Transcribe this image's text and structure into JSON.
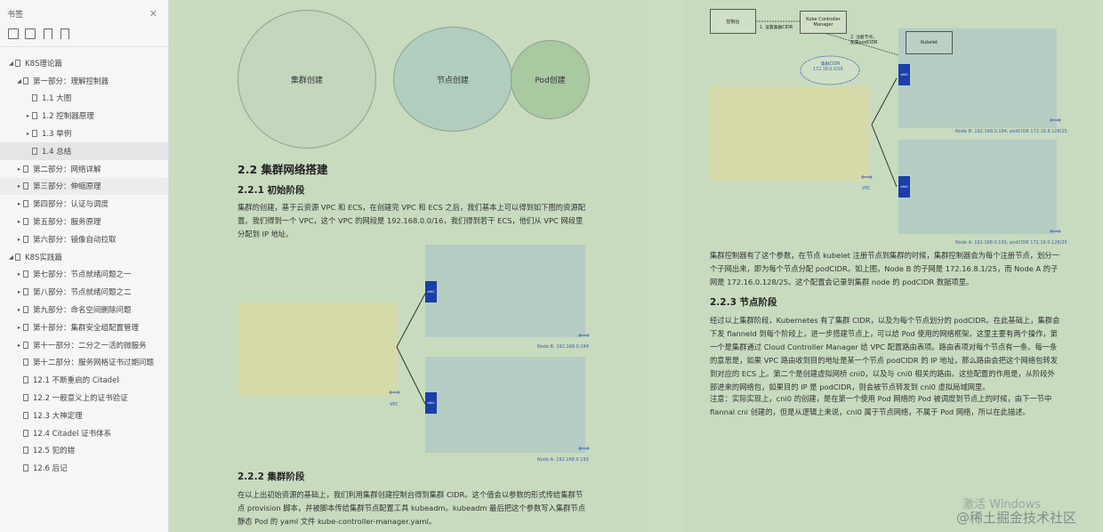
{
  "sidebar": {
    "title": "书签",
    "items": [
      {
        "label": "K8S理论篇",
        "arrow": "◢",
        "indent": 0
      },
      {
        "label": "第一部分：理解控制器",
        "arrow": "◢",
        "indent": 1
      },
      {
        "label": "1.1 大图",
        "arrow": "",
        "indent": 2
      },
      {
        "label": "1.2 控制器原理",
        "arrow": "▸",
        "indent": 2
      },
      {
        "label": "1.3 举例",
        "arrow": "▸",
        "indent": 2
      },
      {
        "label": "1.4 总结",
        "arrow": "",
        "indent": 2,
        "selected": true
      },
      {
        "label": "第二部分：网络详解",
        "arrow": "▸",
        "indent": 1
      },
      {
        "label": "第三部分：伸缩原理",
        "arrow": "▸",
        "indent": 1,
        "hover": true
      },
      {
        "label": "第四部分：认证与调度",
        "arrow": "▸",
        "indent": 1
      },
      {
        "label": "第五部分：服务原理",
        "arrow": "▸",
        "indent": 1
      },
      {
        "label": "第六部分：镜像自动拉取",
        "arrow": "▸",
        "indent": 1
      },
      {
        "label": "K8S实践篇",
        "arrow": "◢",
        "indent": 0
      },
      {
        "label": "第七部分：节点就绪问题之一",
        "arrow": "▸",
        "indent": 1
      },
      {
        "label": "第八部分：节点就绪问题之二",
        "arrow": "▸",
        "indent": 1
      },
      {
        "label": "第九部分：命名空间删除问题",
        "arrow": "▸",
        "indent": 1
      },
      {
        "label": "第十部分：集群安全组配置管理",
        "arrow": "▸",
        "indent": 1
      },
      {
        "label": "第十一部分：二分之一活的微服务",
        "arrow": "▸",
        "indent": 1
      },
      {
        "label": "第十二部分：服务网格证书过期问题",
        "arrow": "",
        "indent": 1
      },
      {
        "label": "12.1 不断重启的 Citadel",
        "arrow": "",
        "indent": 1
      },
      {
        "label": "12.2 一般意义上的证书验证",
        "arrow": "",
        "indent": 1
      },
      {
        "label": "12.3 大神定理",
        "arrow": "",
        "indent": 1
      },
      {
        "label": "12.4 Citadel 证书体系",
        "arrow": "",
        "indent": 1
      },
      {
        "label": "12.5 犯的错",
        "arrow": "",
        "indent": 1
      },
      {
        "label": "12.6 后记",
        "arrow": "",
        "indent": 1
      }
    ]
  },
  "left_page": {
    "circles": [
      "集群创建",
      "节点创建",
      "Pod创建"
    ],
    "h2": "2.2 集群网络搭建",
    "h3_1": "2.2.1 初始阶段",
    "p1": "集群的创建，基于云资源 VPC 和 ECS，在创建完 VPC 和 ECS 之后，我们基本上可以得到如下图的资源配置。我们得到一个 VPC，这个 VPC 的网段是 192.168.0.0/16，我们得到若干 ECS，他们从 VPC 网段里分配到 IP 地址。",
    "diagram": {
      "eth": "eth0",
      "vpc": "VPC",
      "node_b": "Node B: 192.168.0.194",
      "node_a": "Node A: 192.168.0.193"
    },
    "h3_2": "2.2.2 集群阶段",
    "p2": "在以上出初始资源的基础上，我们利用集群创建控制台得到集群 CIDR。这个值会以参数的形式传给集群节点 provision 脚本，并被脚本传给集群节点配置工具 kubeadm。kubeadm 最后把这个参数写入集群节点静态 Pod 的 yaml 文件 kube-controller-manager.yaml。"
  },
  "right_page": {
    "diagram": {
      "console": "控制台",
      "kcm": "Kube Controller Manager",
      "step1": "1. 设置集群CIDR",
      "step2a": "2. 注册节点，",
      "step2b": "配置podCIDR",
      "kubelet": "Kubelet",
      "cloud_title": "集群CIDR",
      "cloud_value": "172.16.0.0/16",
      "eth": "eth0",
      "vpc": "VPC",
      "node_b": "Node B: 192.168.0.194, podCIDR 172.16.8.128/25",
      "node_a": "Node A: 192.168.0.193, podCIDR 172.16.0.128/25"
    },
    "p1": "集群控制器有了这个参数，在节点 kubelet 注册节点到集群的时候，集群控制器会为每个注册节点，划分一个子网出来，即为每个节点分配 podCIDR。如上图，Node B 的子网是 172.16.8.1/25，而 Node A 的子网是 172.16.0.128/25。这个配置会记录到集群 node 的 podCIDR 数据项里。",
    "h3": "2.2.3 节点阶段",
    "p2": "经过以上集群阶段，Kubernetes 有了集群 CIDR，以及为每个节点划分的 podCIDR。在此基础上，集群会下发 flanneld 到每个阶段上，进一步搭建节点上，可以给 Pod 使用的网络框架。这里主要有两个操作，第一个是集群通过 Cloud Controller Manager 给 VPC 配置路由表项。路由表项对每个节点有一条。每一条的意思是，如果 VPC 路由收到目的地址是某一个节点 podCIDR 的 IP 地址，那么路由会把这个网络包转发到对应的 ECS 上。第二个是创建虚拟网桥 cni0，以及与 cni0 相关的路由。这些配置的作用是，从阶段外部进来的网络包，如果目的 IP 是 podCIDR，则会被节点转发到 cni0 虚拟局域网里。",
    "p3": "注意：实际实现上，cni0 的创建，是在第一个使用 Pod 网络的 Pod 被调度到节点上的时候，由下一节中 flannal cni 创建的，但是从逻辑上来说，cni0 属于节点网络，不属于 Pod 网络，所以在此描述。"
  },
  "overlay": {
    "activate": "激活 Windows",
    "watermark": "@稀土掘金技术社区"
  }
}
